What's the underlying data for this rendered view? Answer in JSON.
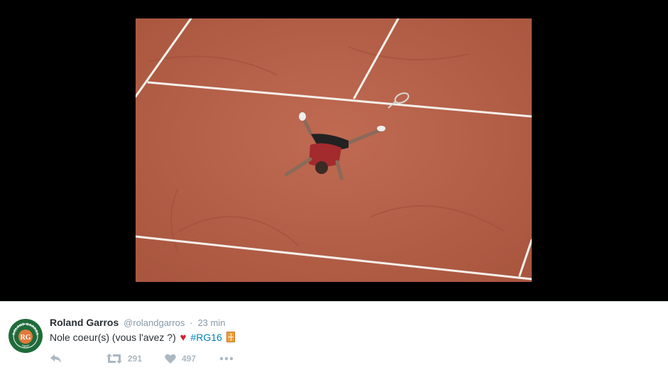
{
  "tweet": {
    "author_name": "Roland Garros",
    "author_handle": "@rolandgarros",
    "separator": "·",
    "timestamp": "23 min",
    "text_before": "Nole coeur(s) (vous l'avez ?)",
    "heart": "♥",
    "hashtag": "#RG16",
    "emoji_after": "tennis-court-emoji"
  },
  "avatar": {
    "text_top": "ROLAND GARROS",
    "monogram": "RG",
    "text_bottom": "PARIS"
  },
  "actions": {
    "retweet_count": "291",
    "like_count": "497",
    "reply_icon": "reply-icon",
    "retweet_icon": "retweet-icon",
    "like_icon": "heart-icon",
    "more_icon": "more-icon"
  },
  "colors": {
    "clay": "#b8614a",
    "link": "#0084b4",
    "text": "#292f33",
    "muted": "#8899a6",
    "action_gray": "#aab8c2",
    "avatar_green": "#1f6b3a",
    "heart_red": "#cc2233"
  }
}
